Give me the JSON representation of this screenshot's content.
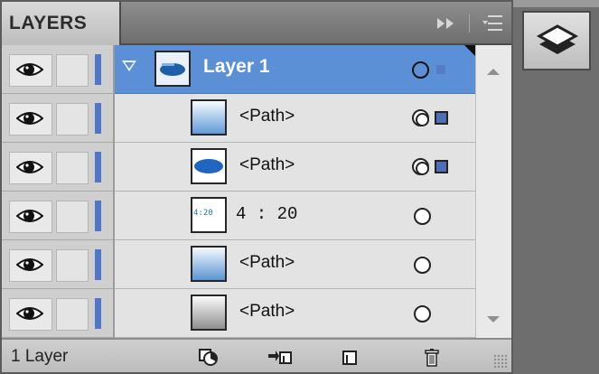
{
  "panel": {
    "tab_label": "LAYERS",
    "icons": [
      "collapse-arrows-icon",
      "panel-menu-icon"
    ]
  },
  "layers": [
    {
      "name": "Layer 1",
      "type": "layer",
      "selected": true,
      "expanded": true,
      "target": "single",
      "thumb": "layer-ellipse"
    },
    {
      "name": "<Path>",
      "type": "sublayer",
      "target": "double",
      "selected_square": true,
      "thumb": "blue-gradient"
    },
    {
      "name": "<Path>",
      "type": "sublayer",
      "target": "double",
      "selected_square": true,
      "thumb": "blue-ellipse"
    },
    {
      "name": "4 : 20",
      "type": "sublayer",
      "target": "single",
      "thumb": "text-4-20",
      "thumb_text": "4:20"
    },
    {
      "name": "<Path>",
      "type": "sublayer",
      "target": "single",
      "thumb": "blue-gradient"
    },
    {
      "name": "<Path>",
      "type": "sublayer",
      "target": "single",
      "thumb": "gray-gradient"
    }
  ],
  "footer": {
    "count_label": "1 Layer",
    "buttons": [
      "make-clipping-mask-icon",
      "create-sublayer-icon",
      "create-new-layer-icon",
      "delete-layer-icon"
    ]
  },
  "colors": {
    "selection": "#5b8fd6",
    "layer_color_bar": "#4f76c8"
  },
  "dock": {
    "icon": "layers-panel-icon"
  }
}
